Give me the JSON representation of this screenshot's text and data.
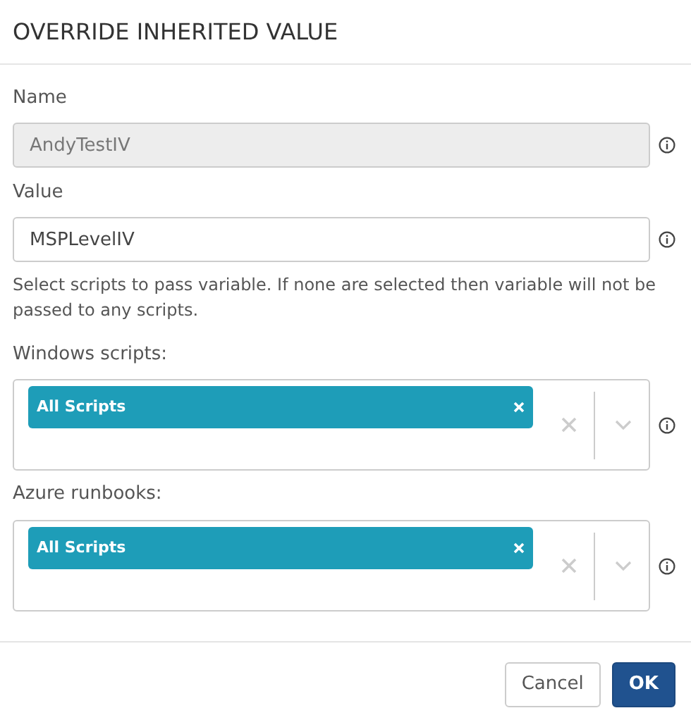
{
  "dialog": {
    "title": "OVERRIDE INHERITED VALUE"
  },
  "fields": [
    {
      "label": "Name",
      "value": "AndyTestIV",
      "disabled": true
    },
    {
      "label": "Value",
      "value": "MSPLevelIV",
      "disabled": false
    }
  ],
  "help_text": "Select scripts to pass variable. If none are selected then variable will not be passed to any scripts.",
  "selects": [
    {
      "label": "Windows scripts:",
      "tags": [
        "All Scripts"
      ]
    },
    {
      "label": "Azure runbooks:",
      "tags": [
        "All Scripts"
      ]
    }
  ],
  "buttons": [
    {
      "label": "Cancel",
      "kind": "secondary"
    },
    {
      "label": "OK",
      "kind": "primary"
    }
  ]
}
